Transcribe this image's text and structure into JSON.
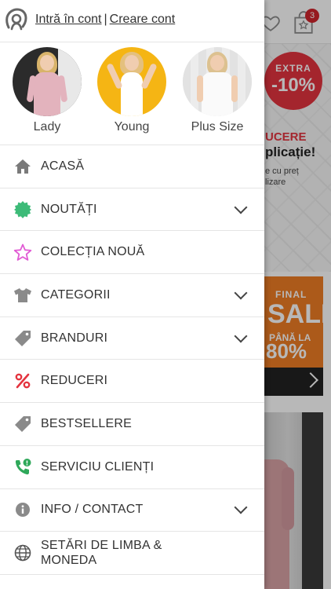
{
  "auth": {
    "login_label": "Intră în cont",
    "separator": "|",
    "register_label": "Creare cont"
  },
  "categories": [
    {
      "label": "Lady",
      "bg": "#2b2b2b",
      "dress": "#e3b3bd"
    },
    {
      "label": "Young",
      "bg": "#f5b514",
      "dress": "#ffffff"
    },
    {
      "label": "Plus Size",
      "bg": "#e9e9e9",
      "dress": "#f6f6f6"
    }
  ],
  "menu": [
    {
      "label": "ACASĂ",
      "icon": "home-icon",
      "color": "#7a7a7a",
      "expandable": false
    },
    {
      "label": "NOUTĂȚI",
      "icon": "badge-icon",
      "color": "#3dbb78",
      "expandable": true
    },
    {
      "label": "COLECȚIA NOUĂ",
      "icon": "star-icon",
      "color": "#e15bd4",
      "expandable": false
    },
    {
      "label": "CATEGORII",
      "icon": "tshirt-icon",
      "color": "#8a8a8a",
      "expandable": true
    },
    {
      "label": "BRANDURI",
      "icon": "tag-icon",
      "color": "#8a8a8a",
      "expandable": true
    },
    {
      "label": "REDUCERI",
      "icon": "percent-icon",
      "color": "#e4343f",
      "expandable": false
    },
    {
      "label": "BESTSELLERE",
      "icon": "tag-icon",
      "color": "#8a8a8a",
      "expandable": false
    },
    {
      "label": "SERVICIU CLIENȚI",
      "icon": "phone-icon",
      "color": "#2fa85a",
      "expandable": false
    },
    {
      "label": "INFO / CONTACT",
      "icon": "info-icon",
      "color": "#8a8a8a",
      "expandable": true
    },
    {
      "label_line1": "SETĂRI DE LIMBA &",
      "label_line2": "MONEDA",
      "icon": "globe-icon",
      "color": "#555555",
      "expandable": false
    }
  ],
  "background": {
    "cart_count": "3",
    "extra_l1": "EXTRA",
    "extra_l2": "-10%",
    "reducere": "UCERE",
    "aplicatie": "plicație!",
    "small1": "e cu preț",
    "small2": "lizare",
    "sale_l1": "FINAL",
    "sale_l2": "SALE",
    "sale_l3": "PÂNĂ LA",
    "sale_l4": "80%"
  }
}
